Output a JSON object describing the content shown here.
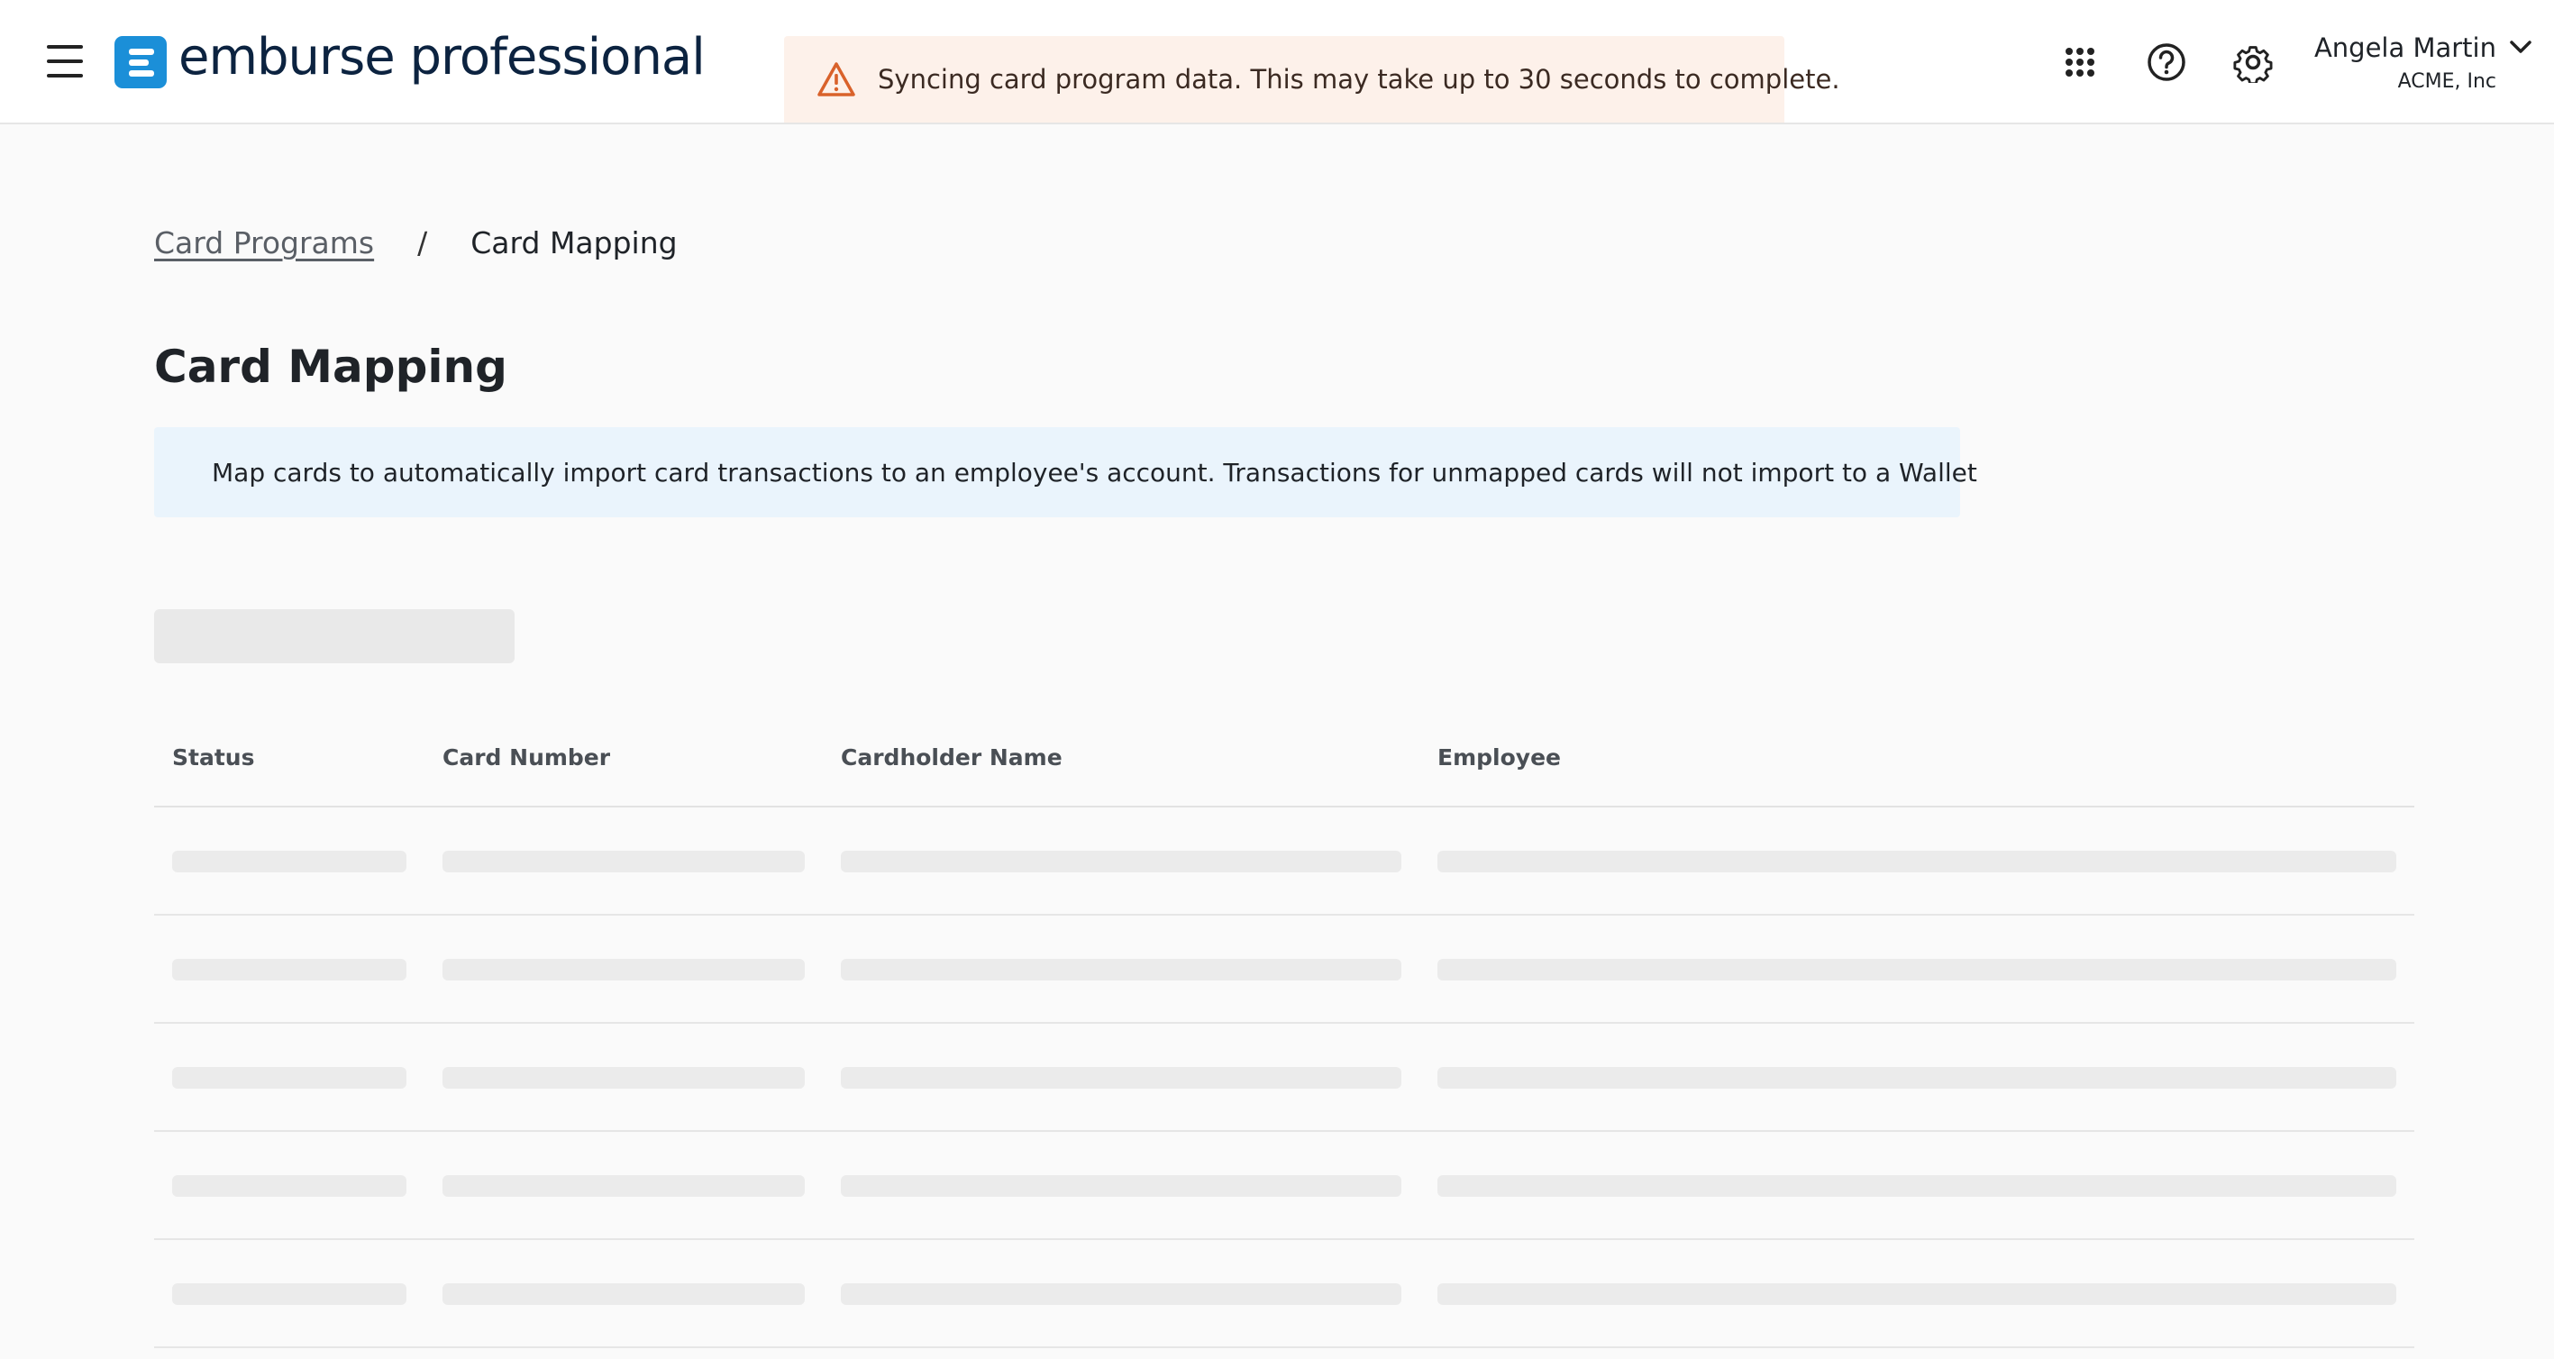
{
  "header": {
    "brand": "emburse professional",
    "sync_message": "Syncing card program data. This may take up to 30 seconds to complete.",
    "user": {
      "name": "Angela Martin",
      "org": "ACME, Inc"
    },
    "icons": [
      "menu-icon",
      "warning-icon",
      "apps-grid-icon",
      "help-icon",
      "gear-icon",
      "chevron-down-icon"
    ]
  },
  "breadcrumb": {
    "parent": "Card Programs",
    "separator": "/",
    "current": "Card Mapping"
  },
  "page": {
    "title": "Card Mapping",
    "info": "Map cards to automatically import card transactions to an employee's account. Transactions for unmapped cards will not import to a Wallet"
  },
  "table": {
    "columns": [
      "Status",
      "Card Number",
      "Cardholder Name",
      "Employee"
    ],
    "loading": true
  },
  "colors": {
    "brand_blue": "#1b8fd8",
    "brand_navy": "#0c2340",
    "warning": "#d9622b",
    "warning_bg": "#fdf1ea",
    "info": "#1b7fc4",
    "info_bg": "#eaf4fc"
  }
}
